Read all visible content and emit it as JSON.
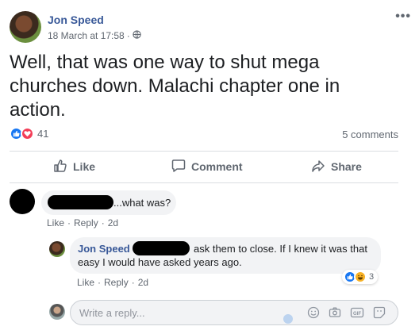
{
  "post": {
    "author": "Jon Speed",
    "timestamp": "18 March at 17:58",
    "separator": "·",
    "text": "Well, that was one way to shut mega churches down. Malachi chapter one in action.",
    "reaction_count": "41",
    "comments_count": "5 comments"
  },
  "actions": {
    "like": "Like",
    "comment": "Comment",
    "share": "Share"
  },
  "comment1": {
    "text": "...what was?",
    "like": "Like",
    "reply": "Reply",
    "age": "2d",
    "dot": "·"
  },
  "reply1": {
    "author": "Jon Speed",
    "text_line1": "ask them to close. If I knew it was that",
    "text_line2": "easy I would have asked years ago.",
    "like": "Like",
    "reply": "Reply",
    "age": "2d",
    "dot": "·",
    "reaction_count": "3"
  },
  "reply_input": {
    "placeholder": "Write a reply..."
  },
  "colors": {
    "link": "#385898",
    "like_blue": "#1877f2",
    "love_red": "#f33e58"
  }
}
